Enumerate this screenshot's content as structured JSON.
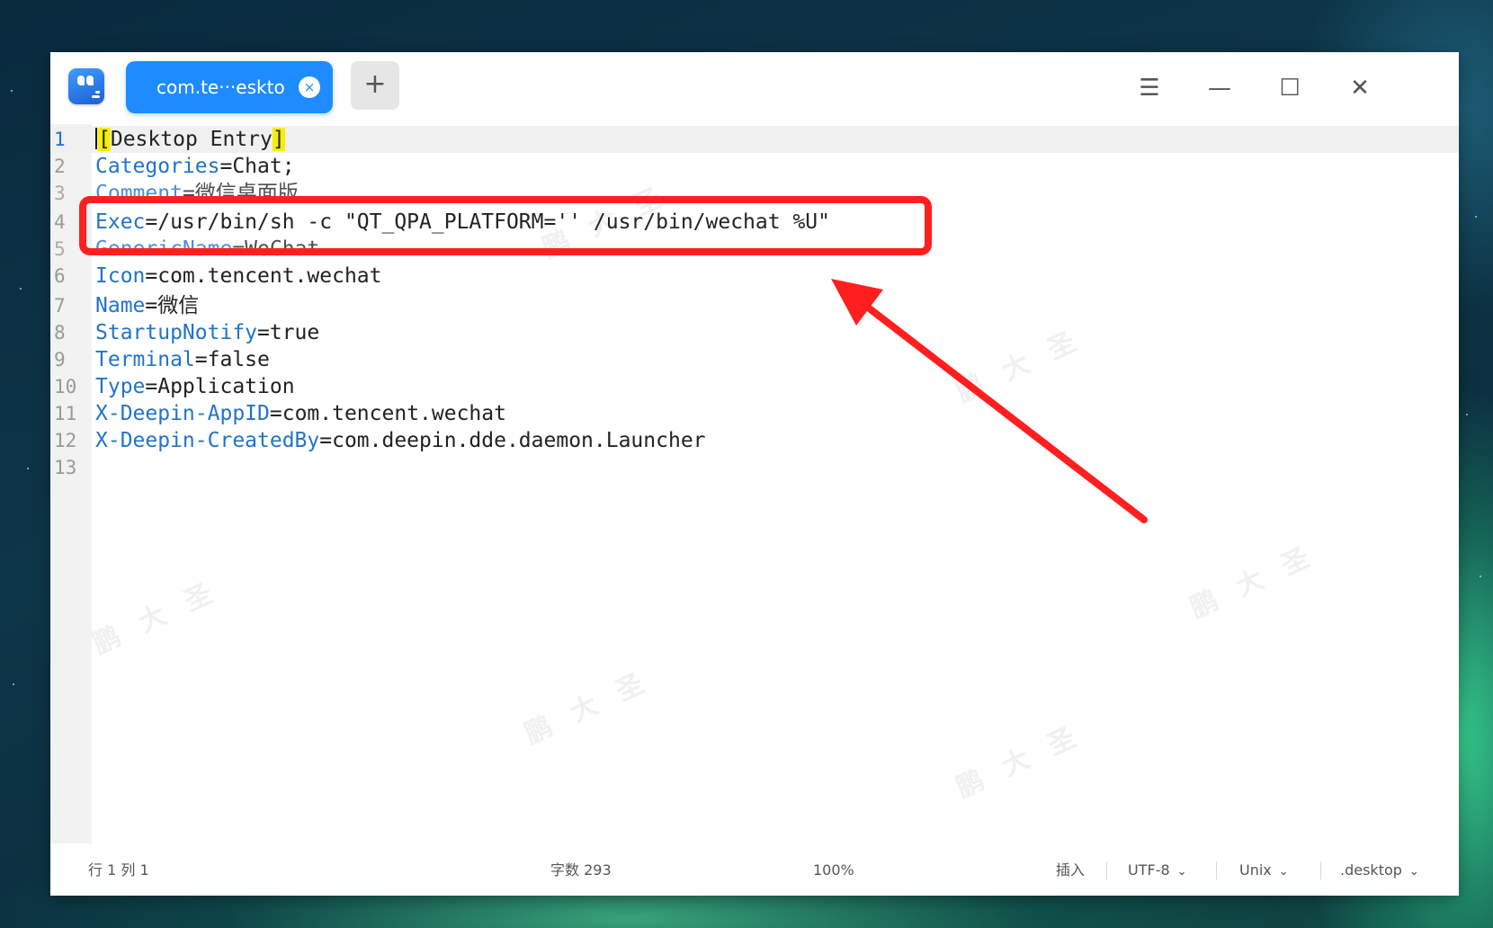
{
  "window": {
    "tab_label": "com.te···eskto",
    "tab_close_glyph": "×",
    "new_tab_glyph": "+",
    "menu_glyph": "☰",
    "minimize_glyph": "—",
    "maximize_glyph": "☐",
    "close_glyph": "✕"
  },
  "editor": {
    "line_numbers": [
      "1",
      "2",
      "3",
      "4",
      "5",
      "6",
      "7",
      "8",
      "9",
      "10",
      "11",
      "12",
      "13"
    ],
    "lines": [
      {
        "key": "",
        "value": ""
      },
      {
        "key": "Categories",
        "value": "=Chat;"
      },
      {
        "key": "Comment",
        "value": "=微信桌面版"
      },
      {
        "key": "Exec",
        "value": "=/usr/bin/sh -c \"QT_QPA_PLATFORM='' /usr/bin/wechat %U\""
      },
      {
        "key": "GenericName",
        "value": "=WeChat"
      },
      {
        "key": "Icon",
        "value": "=com.tencent.wechat"
      },
      {
        "key": "Name",
        "value": "=微信"
      },
      {
        "key": "StartupNotify",
        "value": "=true"
      },
      {
        "key": "Terminal",
        "value": "=false"
      },
      {
        "key": "Type",
        "value": "=Application"
      },
      {
        "key": "X-Deepin-AppID",
        "value": "=com.tencent.wechat"
      },
      {
        "key": "X-Deepin-CreatedBy",
        "value": "=com.deepin.dde.daemon.Launcher"
      },
      {
        "key": "",
        "value": ""
      }
    ],
    "section_open": "[",
    "section_name": "Desktop Entry",
    "section_close": "]"
  },
  "statusbar": {
    "position": "行 1  列 1",
    "char_count": "字数 293",
    "zoom": "100%",
    "mode": "插入",
    "encoding": "UTF-8",
    "line_ending": "Unix",
    "file_type": ".desktop"
  },
  "watermark_text": "鹏大圣",
  "colors": {
    "tab_active": "#1e8cff",
    "key": "#2174c8",
    "bracket_highlight": "#f5f000",
    "annotation": "#ff1f1f"
  }
}
